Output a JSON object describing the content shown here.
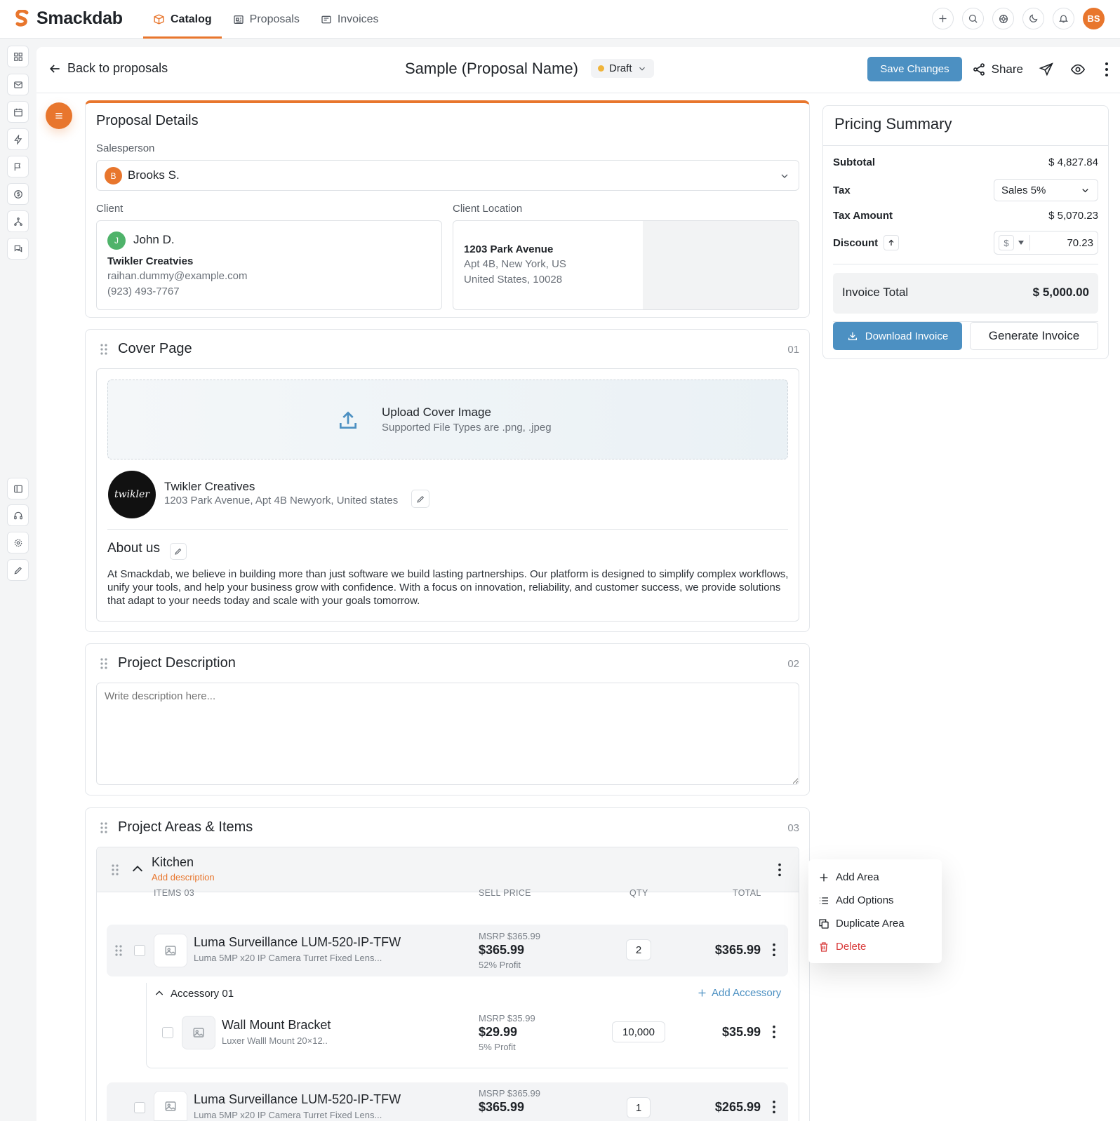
{
  "brand": {
    "name": "Smackdab",
    "accent": "#e8762d",
    "primary": "#4c90c2"
  },
  "nav": [
    {
      "label": "Catalog",
      "icon": "box-icon",
      "active": true
    },
    {
      "label": "Proposals",
      "icon": "newspaper-icon",
      "active": false
    },
    {
      "label": "Invoices",
      "icon": "receipt-icon",
      "active": false
    }
  ],
  "user": {
    "initials": "BS"
  },
  "header": {
    "back_label": "Back to proposals",
    "title": "Sample (Proposal Name)",
    "status": "Draft",
    "save_label": "Save Changes",
    "share_label": "Share"
  },
  "details": {
    "title": "Proposal Details",
    "salesperson_label": "Salesperson",
    "salesperson_initial": "B",
    "salesperson_name": "Brooks S.",
    "client_label": "Client",
    "client_initial": "J",
    "client_name": "John D.",
    "client_company": "Twikler Creatvies",
    "client_email": "raihan.dummy@example.com",
    "client_phone": "(923) 493-7767",
    "location_label": "Client Location",
    "address_line1": "1203 Park Avenue",
    "address_line2": "Apt 4B, New York, US",
    "address_line3": "United States, 10028"
  },
  "cover": {
    "title": "Cover Page",
    "number": "01",
    "upload_title": "Upload Cover Image",
    "upload_sub": "Supported File Types are .png, .jpeg",
    "company_logo_text": "twikler",
    "company_name": "Twikler Creatives",
    "company_address": "1203 Park Avenue, Apt 4B Newyork, United states",
    "about_title": "About us",
    "about_text": "At Smackdab, we believe in building more than just software we build lasting partnerships. Our platform is designed to simplify complex workflows, unify your tools, and help your business grow with confidence. With a focus on innovation, reliability, and customer success, we provide solutions that adapt to your needs today and scale with your goals tomorrow."
  },
  "description": {
    "title": "Project Description",
    "number": "02",
    "placeholder": "Write description here..."
  },
  "areas": {
    "title": "Project Areas & Items",
    "number": "03",
    "area_name": "Kitchen",
    "add_description": "Add description",
    "columns": {
      "items": "ITEMS 03",
      "sell_price": "SELL PRICE",
      "qty": "QTY",
      "total": "TOTAL"
    },
    "items": [
      {
        "name": "Luma Surveillance LUM-520-IP-TFW",
        "sub": "Luma 5MP x20 IP Camera Turret Fixed Lens...",
        "msrp": "MSRP $365.99",
        "price": "$365.99",
        "profit": "52% Profit",
        "qty": "2",
        "total": "$365.99"
      },
      {
        "name": "Luma Surveillance LUM-520-IP-TFW",
        "sub": "Luma 5MP x20 IP Camera Turret Fixed Lens...",
        "msrp": "MSRP $365.99",
        "price": "$365.99",
        "profit": "",
        "qty": "1",
        "total": "$265.99"
      }
    ],
    "accessory_group": "Accessory 01",
    "add_accessory": "Add Accessory",
    "accessory": {
      "name": "Wall Mount Bracket",
      "sub": "Luxer Walll Mount 20×12..",
      "msrp": "MSRP $35.99",
      "price": "$29.99",
      "profit": "5% Profit",
      "qty": "10,000",
      "total": "$35.99"
    }
  },
  "pricing": {
    "title": "Pricing Summary",
    "subtotal_label": "Subtotal",
    "subtotal": "$ 4,827.84",
    "tax_label": "Tax",
    "tax_value": "Sales 5%",
    "tax_amount_label": "Tax Amount",
    "tax_amount": "$ 5,070.23",
    "discount_label": "Discount",
    "discount_currency": "$",
    "discount_value": "70.23",
    "invoice_total_label": "Invoice Total",
    "invoice_total": "$ 5,000.00",
    "download_label": "Download Invoice",
    "generate_label": "Generate Invoice"
  },
  "menu": [
    {
      "label": "Add Area",
      "icon": "plus-icon"
    },
    {
      "label": "Add Options",
      "icon": "list-icon"
    },
    {
      "label": "Duplicate Area",
      "icon": "duplicate-icon"
    },
    {
      "label": "Delete",
      "icon": "trash-icon",
      "color": "#d83a3a"
    }
  ]
}
